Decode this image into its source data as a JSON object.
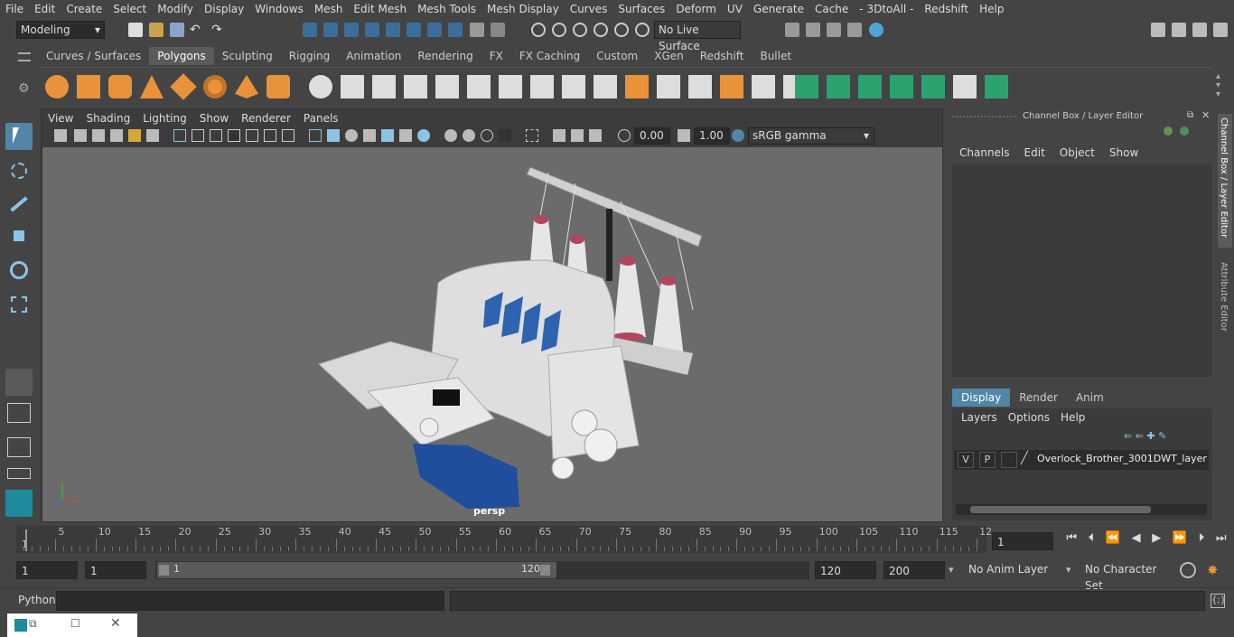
{
  "menubar": [
    "File",
    "Edit",
    "Create",
    "Select",
    "Modify",
    "Display",
    "Windows",
    "Mesh",
    "Edit Mesh",
    "Mesh Tools",
    "Mesh Display",
    "Curves",
    "Surfaces",
    "Deform",
    "UV",
    "Generate",
    "Cache",
    "- 3DtoAll -",
    "Redshift",
    "Help"
  ],
  "status": {
    "mode": "Modeling",
    "live_surface": "No Live Surface"
  },
  "shelf_tabs": [
    "Curves / Surfaces",
    "Polygons",
    "Sculpting",
    "Rigging",
    "Animation",
    "Rendering",
    "FX",
    "FX Caching",
    "Custom",
    "XGen",
    "Redshift",
    "Bullet"
  ],
  "shelf_active": "Polygons",
  "view_menu": [
    "View",
    "Shading",
    "Lighting",
    "Show",
    "Renderer",
    "Panels"
  ],
  "view": {
    "exposure": "0.00",
    "gamma": "1.00",
    "colorspace": "sRGB gamma",
    "camera_label": "persp"
  },
  "channelbox": {
    "title": "Channel Box / Layer Editor",
    "menu": [
      "Channels",
      "Edit",
      "Object",
      "Show"
    ],
    "layer_tabs": [
      "Display",
      "Render",
      "Anim"
    ],
    "layer_menu": [
      "Layers",
      "Options",
      "Help"
    ],
    "layer": {
      "v": "V",
      "p": "P",
      "name": "Overlock_Brother_3001DWT_layer"
    },
    "side_tabs": [
      "Channel Box / Layer Editor",
      "Attribute Editor"
    ]
  },
  "timeline": {
    "ticks": [
      "5",
      "10",
      "15",
      "20",
      "25",
      "30",
      "35",
      "40",
      "45",
      "50",
      "55",
      "60",
      "65",
      "70",
      "75",
      "80",
      "85",
      "90",
      "95",
      "100",
      "105",
      "110",
      "115",
      "12"
    ],
    "start_marker": "1",
    "current_frame": "1"
  },
  "range": {
    "start": "1",
    "playback_start": "1",
    "slider_start": "1",
    "slider_end": "120",
    "end": "120",
    "anim_end": "200",
    "anim_layer": "No Anim Layer",
    "char_set": "No Character Set"
  },
  "cmdline": {
    "label": "Python"
  },
  "colors": {
    "accent": "#5285a6",
    "bg": "#444444",
    "viewport": "#6b6b6b",
    "shelf_green": "#2aa36f",
    "shelf_orange": "#e8933a"
  }
}
